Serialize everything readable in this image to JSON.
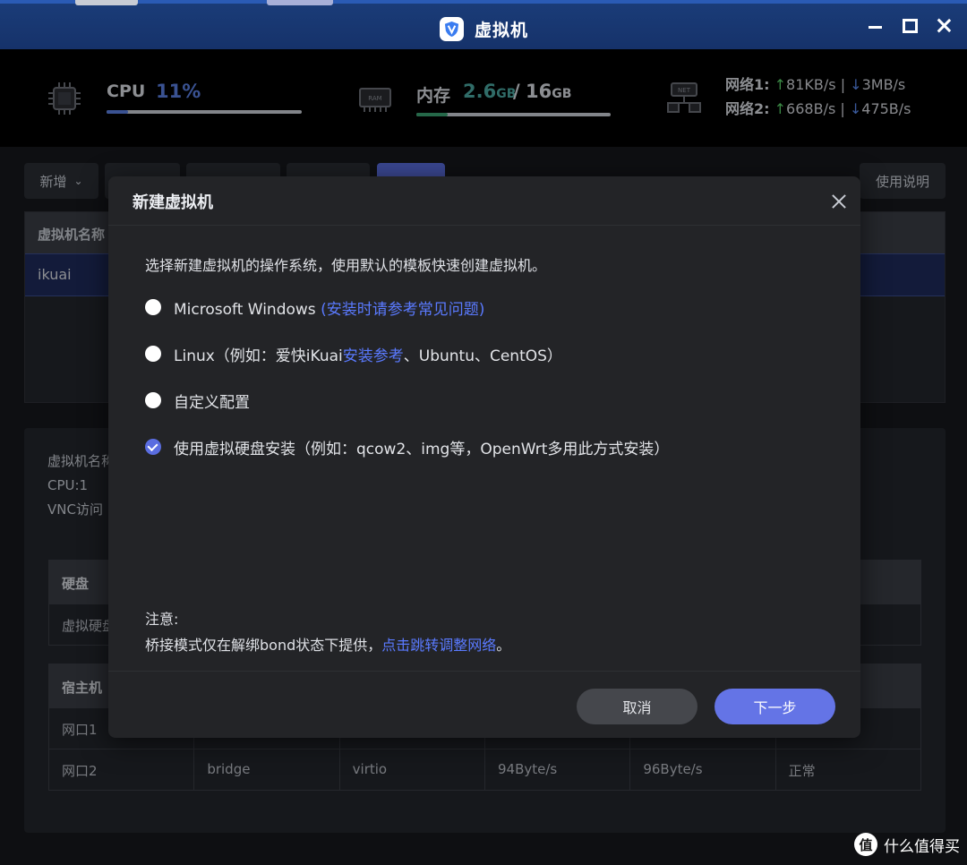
{
  "window": {
    "title": "虚拟机",
    "controls": [
      "minimize",
      "maximize",
      "close"
    ]
  },
  "stats": {
    "cpu": {
      "label": "CPU",
      "value": "11%",
      "progress": 0.11
    },
    "memory": {
      "label": "内存",
      "used": "2.6",
      "used_unit": "GB",
      "separator": "/",
      "total": "16",
      "total_unit": "GB",
      "progress": 0.16
    },
    "network": {
      "net1_label": "网络1:",
      "net1_up": "81KB/s",
      "net1_down": "3MB/s",
      "net2_label": "网络2:",
      "net2_up": "668B/s",
      "net2_down": "475B/s"
    }
  },
  "toolbar": {
    "add_label": "新增",
    "help_label": "使用说明"
  },
  "vm_table": {
    "header_name": "虚拟机名称",
    "row_name": "ikuai"
  },
  "details": {
    "line1": "虚拟机名称",
    "line2": "CPU:1",
    "line3": "VNC访问",
    "disk_header": "硬盘",
    "disk_row": "虚拟硬盘",
    "host_header": "宿主机",
    "port1": "网口1",
    "port2": "网口2",
    "port2_mode": "bridge",
    "port2_driver": "virtio",
    "port2_rx": "94Byte/s",
    "port2_tx": "96Byte/s",
    "port2_status": "正常"
  },
  "modal": {
    "title": "新建虚拟机",
    "description": "选择新建虚拟机的操作系统，使用默认的模板快速创建虚拟机。",
    "options": [
      {
        "label": "Microsoft Windows",
        "link": "(安装时请参考常见问题)",
        "checked": false
      },
      {
        "label_pre": "Linux（例如：爱快iKuai",
        "link": "安装参考",
        "label_post": "、Ubuntu、CentOS）",
        "checked": false
      },
      {
        "label": "自定义配置",
        "checked": false
      },
      {
        "label": "使用虚拟硬盘安装（例如：qcow2、img等，OpenWrt多用此方式安装）",
        "checked": true
      }
    ],
    "notice_title": "注意:",
    "notice_text": "桥接模式仅在解绑bond状态下提供，",
    "notice_link": "点击跳转调整网络",
    "notice_end": "。",
    "cancel_label": "取消",
    "next_label": "下一步"
  },
  "watermark": {
    "logo": "值",
    "text": "什么值得买"
  },
  "colors": {
    "accent": "#6474e6",
    "link": "#5a7aff",
    "up_arrow": "#5ad06a",
    "down_arrow": "#5a8af0"
  }
}
